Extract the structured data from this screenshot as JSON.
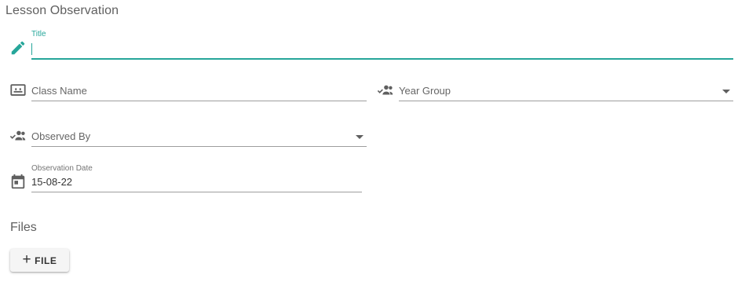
{
  "form": {
    "title": "Lesson Observation",
    "fields": {
      "title": {
        "label": "Title",
        "value": ""
      },
      "class_name": {
        "placeholder": "Class Name"
      },
      "year_group": {
        "placeholder": "Year Group"
      },
      "observed_by": {
        "placeholder": "Observed By"
      },
      "observation_date": {
        "label": "Observation Date",
        "value": "15-08-22"
      }
    },
    "files": {
      "title": "Files",
      "add_icon": "+",
      "add_label": "FILE"
    }
  },
  "icons": {
    "title": "pencil-icon",
    "class_name": "class-board-icon",
    "year_group": "group-check-icon",
    "observed_by": "group-check-icon",
    "observation_date": "calendar-icon"
  },
  "colors": {
    "accent": "#26a69a",
    "icon": "#5f5f5f",
    "underline": "#9e9e9e",
    "text": "#666666"
  }
}
